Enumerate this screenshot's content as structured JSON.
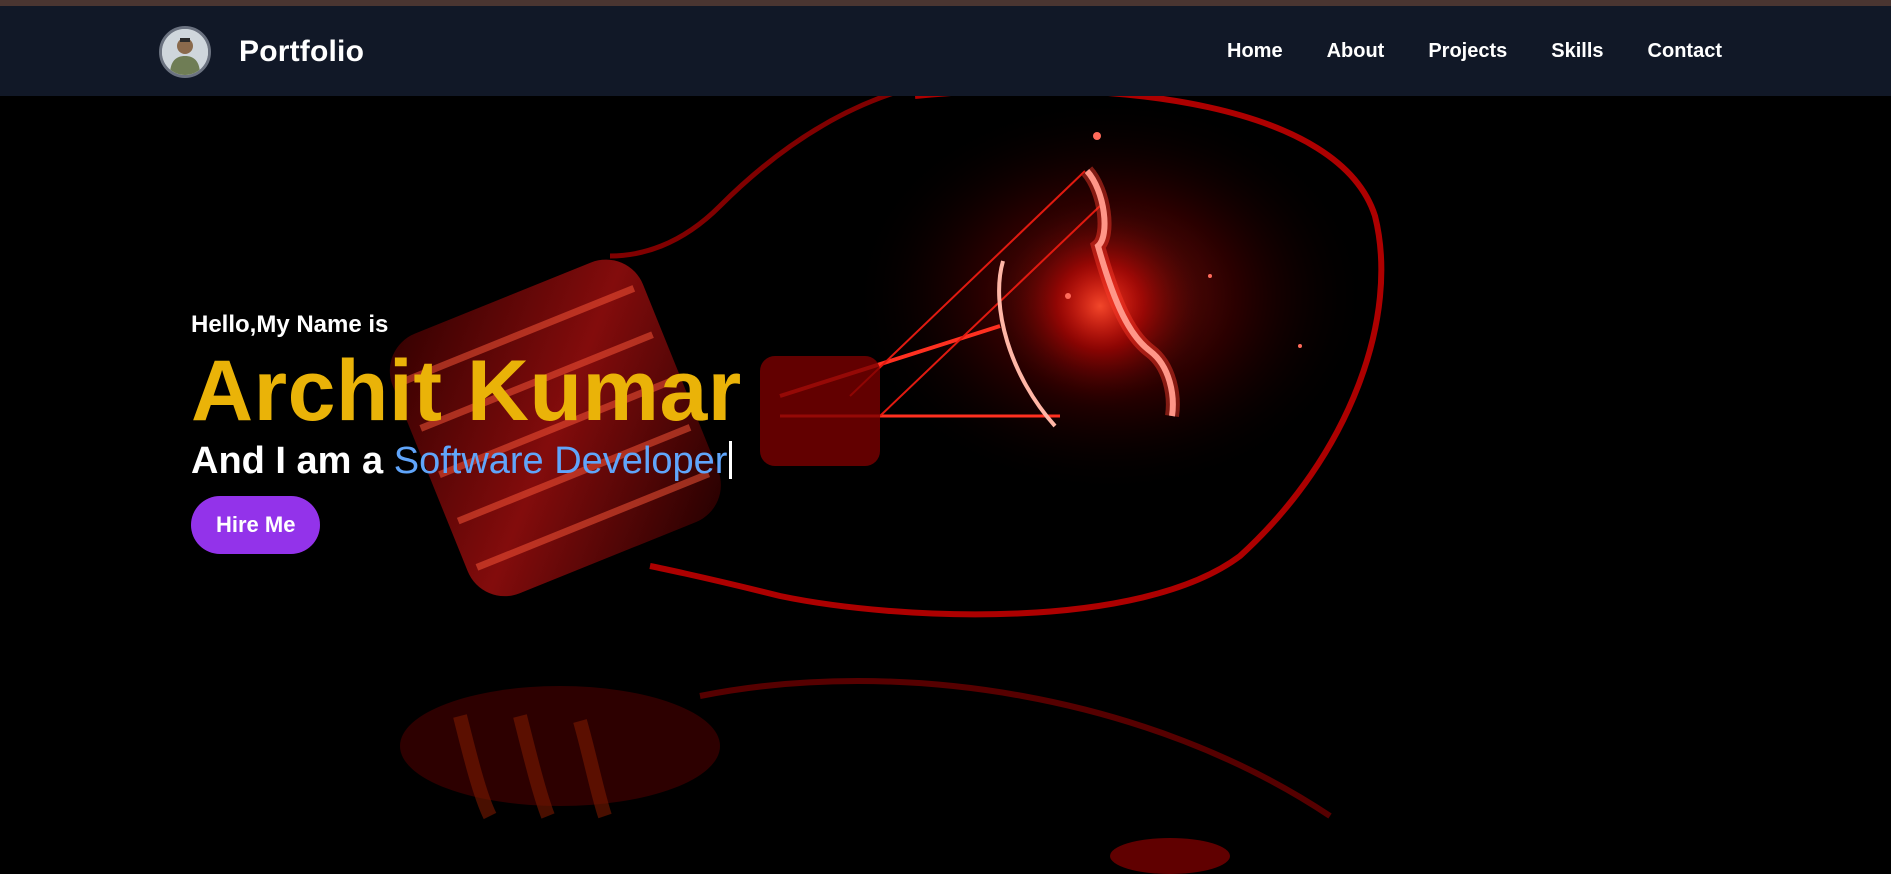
{
  "brand": {
    "title": "Portfolio",
    "avatar_icon": "profile-photo"
  },
  "nav": {
    "items": [
      {
        "label": "Home"
      },
      {
        "label": "About"
      },
      {
        "label": "Projects"
      },
      {
        "label": "Skills"
      },
      {
        "label": "Contact"
      }
    ]
  },
  "hero": {
    "greeting": "Hello,My Name is",
    "name": "Archit Kumar",
    "role_prefix": "And I am a ",
    "role_typed": "Software Developer",
    "cta_label": "Hire Me",
    "background_icon": "lightbulb-image"
  },
  "colors": {
    "navbar_bg": "#111827",
    "name": "#eab308",
    "role_typed": "#60a5fa",
    "cta_bg": "#9333ea",
    "bulb_glow": "#ff1a1a"
  }
}
